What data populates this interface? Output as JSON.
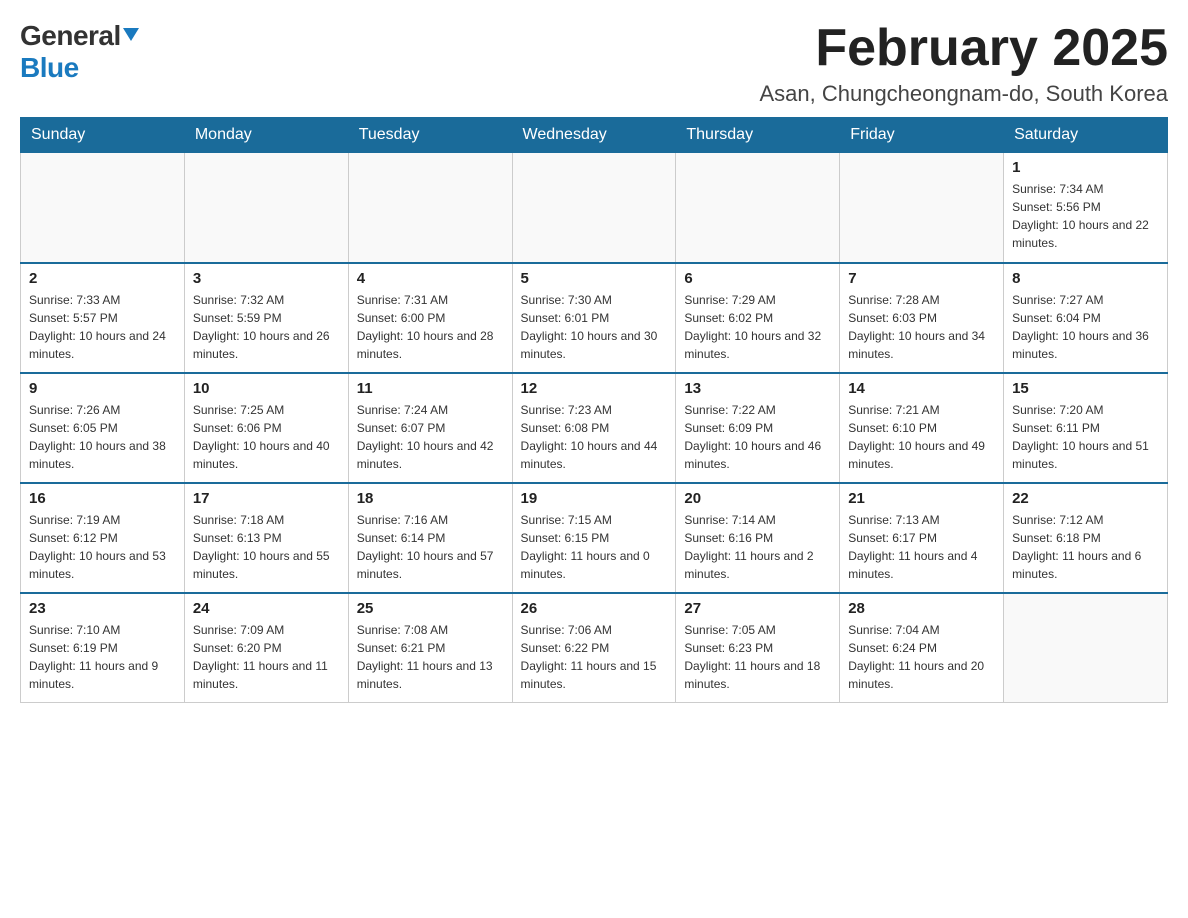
{
  "logo": {
    "general": "General",
    "blue": "Blue"
  },
  "title": {
    "month_year": "February 2025",
    "location": "Asan, Chungcheongnam-do, South Korea"
  },
  "days_of_week": [
    "Sunday",
    "Monday",
    "Tuesday",
    "Wednesday",
    "Thursday",
    "Friday",
    "Saturday"
  ],
  "weeks": [
    [
      {
        "day": "",
        "info": ""
      },
      {
        "day": "",
        "info": ""
      },
      {
        "day": "",
        "info": ""
      },
      {
        "day": "",
        "info": ""
      },
      {
        "day": "",
        "info": ""
      },
      {
        "day": "",
        "info": ""
      },
      {
        "day": "1",
        "info": "Sunrise: 7:34 AM\nSunset: 5:56 PM\nDaylight: 10 hours and 22 minutes."
      }
    ],
    [
      {
        "day": "2",
        "info": "Sunrise: 7:33 AM\nSunset: 5:57 PM\nDaylight: 10 hours and 24 minutes."
      },
      {
        "day": "3",
        "info": "Sunrise: 7:32 AM\nSunset: 5:59 PM\nDaylight: 10 hours and 26 minutes."
      },
      {
        "day": "4",
        "info": "Sunrise: 7:31 AM\nSunset: 6:00 PM\nDaylight: 10 hours and 28 minutes."
      },
      {
        "day": "5",
        "info": "Sunrise: 7:30 AM\nSunset: 6:01 PM\nDaylight: 10 hours and 30 minutes."
      },
      {
        "day": "6",
        "info": "Sunrise: 7:29 AM\nSunset: 6:02 PM\nDaylight: 10 hours and 32 minutes."
      },
      {
        "day": "7",
        "info": "Sunrise: 7:28 AM\nSunset: 6:03 PM\nDaylight: 10 hours and 34 minutes."
      },
      {
        "day": "8",
        "info": "Sunrise: 7:27 AM\nSunset: 6:04 PM\nDaylight: 10 hours and 36 minutes."
      }
    ],
    [
      {
        "day": "9",
        "info": "Sunrise: 7:26 AM\nSunset: 6:05 PM\nDaylight: 10 hours and 38 minutes."
      },
      {
        "day": "10",
        "info": "Sunrise: 7:25 AM\nSunset: 6:06 PM\nDaylight: 10 hours and 40 minutes."
      },
      {
        "day": "11",
        "info": "Sunrise: 7:24 AM\nSunset: 6:07 PM\nDaylight: 10 hours and 42 minutes."
      },
      {
        "day": "12",
        "info": "Sunrise: 7:23 AM\nSunset: 6:08 PM\nDaylight: 10 hours and 44 minutes."
      },
      {
        "day": "13",
        "info": "Sunrise: 7:22 AM\nSunset: 6:09 PM\nDaylight: 10 hours and 46 minutes."
      },
      {
        "day": "14",
        "info": "Sunrise: 7:21 AM\nSunset: 6:10 PM\nDaylight: 10 hours and 49 minutes."
      },
      {
        "day": "15",
        "info": "Sunrise: 7:20 AM\nSunset: 6:11 PM\nDaylight: 10 hours and 51 minutes."
      }
    ],
    [
      {
        "day": "16",
        "info": "Sunrise: 7:19 AM\nSunset: 6:12 PM\nDaylight: 10 hours and 53 minutes."
      },
      {
        "day": "17",
        "info": "Sunrise: 7:18 AM\nSunset: 6:13 PM\nDaylight: 10 hours and 55 minutes."
      },
      {
        "day": "18",
        "info": "Sunrise: 7:16 AM\nSunset: 6:14 PM\nDaylight: 10 hours and 57 minutes."
      },
      {
        "day": "19",
        "info": "Sunrise: 7:15 AM\nSunset: 6:15 PM\nDaylight: 11 hours and 0 minutes."
      },
      {
        "day": "20",
        "info": "Sunrise: 7:14 AM\nSunset: 6:16 PM\nDaylight: 11 hours and 2 minutes."
      },
      {
        "day": "21",
        "info": "Sunrise: 7:13 AM\nSunset: 6:17 PM\nDaylight: 11 hours and 4 minutes."
      },
      {
        "day": "22",
        "info": "Sunrise: 7:12 AM\nSunset: 6:18 PM\nDaylight: 11 hours and 6 minutes."
      }
    ],
    [
      {
        "day": "23",
        "info": "Sunrise: 7:10 AM\nSunset: 6:19 PM\nDaylight: 11 hours and 9 minutes."
      },
      {
        "day": "24",
        "info": "Sunrise: 7:09 AM\nSunset: 6:20 PM\nDaylight: 11 hours and 11 minutes."
      },
      {
        "day": "25",
        "info": "Sunrise: 7:08 AM\nSunset: 6:21 PM\nDaylight: 11 hours and 13 minutes."
      },
      {
        "day": "26",
        "info": "Sunrise: 7:06 AM\nSunset: 6:22 PM\nDaylight: 11 hours and 15 minutes."
      },
      {
        "day": "27",
        "info": "Sunrise: 7:05 AM\nSunset: 6:23 PM\nDaylight: 11 hours and 18 minutes."
      },
      {
        "day": "28",
        "info": "Sunrise: 7:04 AM\nSunset: 6:24 PM\nDaylight: 11 hours and 20 minutes."
      },
      {
        "day": "",
        "info": ""
      }
    ]
  ]
}
